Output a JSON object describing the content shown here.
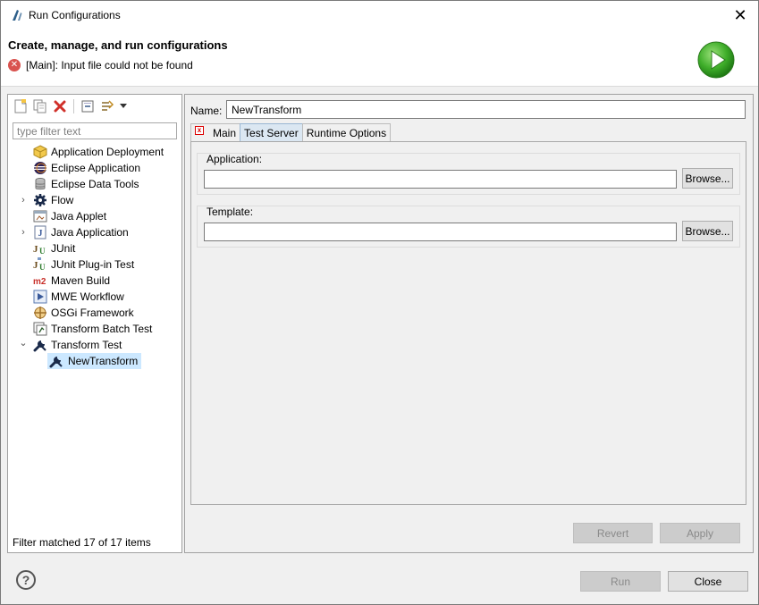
{
  "window": {
    "title": "Run Configurations",
    "close_glyph": "✕"
  },
  "header": {
    "heading": "Create, manage, and run configurations",
    "error_message": "[Main]: Input file could not be found",
    "error_glyph": "✕"
  },
  "left_panel": {
    "filter_placeholder": "type filter text",
    "filter_value": "",
    "tree": [
      {
        "label": "Application Deployment",
        "icon": "deployment-icon",
        "expandable": false,
        "expanded": false
      },
      {
        "label": "Eclipse Application",
        "icon": "eclipse-icon",
        "expandable": false,
        "expanded": false
      },
      {
        "label": "Eclipse Data Tools",
        "icon": "database-icon",
        "expandable": false,
        "expanded": false
      },
      {
        "label": "Flow",
        "icon": "gear-icon",
        "expandable": true,
        "expanded": false
      },
      {
        "label": "Java Applet",
        "icon": "applet-icon",
        "expandable": false,
        "expanded": false
      },
      {
        "label": "Java Application",
        "icon": "java-app-icon",
        "expandable": true,
        "expanded": false
      },
      {
        "label": "JUnit",
        "icon": "junit-icon",
        "expandable": false,
        "expanded": false
      },
      {
        "label": "JUnit Plug-in Test",
        "icon": "junit-plugin-icon",
        "expandable": false,
        "expanded": false
      },
      {
        "label": "Maven Build",
        "icon": "maven-icon",
        "expandable": false,
        "expanded": false
      },
      {
        "label": "MWE Workflow",
        "icon": "mwe-workflow-icon",
        "expandable": false,
        "expanded": false
      },
      {
        "label": "OSGi Framework",
        "icon": "osgi-icon",
        "expandable": false,
        "expanded": false
      },
      {
        "label": "Transform Batch Test",
        "icon": "batch-test-icon",
        "expandable": false,
        "expanded": false
      },
      {
        "label": "Transform Test",
        "icon": "wrench-icon",
        "expandable": true,
        "expanded": true
      },
      {
        "label": "NewTransform",
        "icon": "wrench-icon",
        "child": true,
        "selected": true
      }
    ],
    "filter_status": "Filter matched 17 of 17 items",
    "twisty_collapsed": "›",
    "twisty_expanded": "⌄"
  },
  "right_panel": {
    "name_label": "Name:",
    "name_value": "NewTransform",
    "tabs": [
      {
        "label": "Main",
        "error": true,
        "active": false
      },
      {
        "label": "Test Server",
        "error": false,
        "active": true
      },
      {
        "label": "Runtime Options",
        "error": false,
        "active": false
      }
    ],
    "application": {
      "label": "Application:",
      "value": "",
      "browse_label": "Browse..."
    },
    "template": {
      "label": "Template:",
      "value": "",
      "browse_label": "Browse..."
    },
    "revert_label": "Revert",
    "apply_label": "Apply"
  },
  "footer": {
    "help_glyph": "?",
    "run_label": "Run",
    "close_label": "Close"
  },
  "colors": {
    "selection": "#cce8ff",
    "active_tab": "#dbe7f2",
    "error": "#d9534f",
    "run_green": "#3fae2a"
  }
}
